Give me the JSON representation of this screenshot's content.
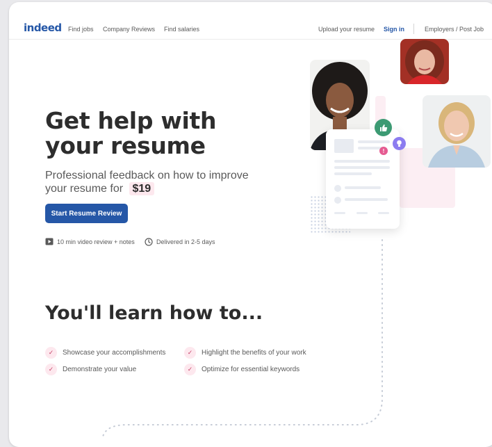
{
  "nav": {
    "logo": "indeed",
    "links": [
      "Find jobs",
      "Company Reviews",
      "Find salaries"
    ],
    "upload_resume": "Upload your resume",
    "sign_in": "Sign in",
    "employers": "Employers / Post Job"
  },
  "hero": {
    "title": "Get help with your resume",
    "subtitle": "Professional feedback on how to improve your resume for",
    "price": "$19",
    "cta": "Start Resume Review",
    "meta_video": "10 min video review + notes",
    "meta_delivery": "Delivered in 2-5 days"
  },
  "learn": {
    "title": "You'll learn how to...",
    "items": [
      "Showcase your accomplishments",
      "Highlight the benefits of your work",
      "Demonstrate your value",
      "Optimize for essential keywords"
    ]
  },
  "colors": {
    "brand": "#2557a7",
    "accent_pink": "#fde8ee",
    "text_dark": "#2d2d2d",
    "text_muted": "#595959"
  },
  "icons": [
    "video-icon",
    "clock-icon",
    "check-icon",
    "thumbs-up-icon",
    "lightbulb-icon",
    "alert-icon"
  ]
}
